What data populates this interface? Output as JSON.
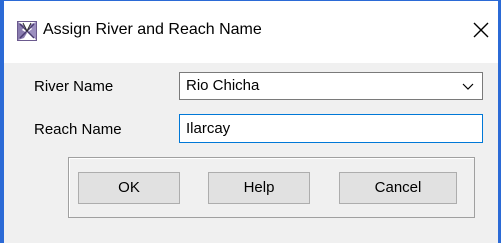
{
  "window": {
    "title": "Assign River and Reach Name",
    "icon": "hec-ras-app-icon",
    "close_icon": "close-icon"
  },
  "form": {
    "river_label": "River Name",
    "river_value": "Rio Chicha",
    "reach_label": "Reach Name",
    "reach_value": "Ilarcay"
  },
  "buttons": {
    "ok": "OK",
    "help": "Help",
    "cancel": "Cancel"
  },
  "colors": {
    "accent": "#0078d7",
    "window_edge": "#2b6ad6",
    "dialog_bg": "#f0f0f0",
    "button_bg": "#e1e1e1"
  }
}
